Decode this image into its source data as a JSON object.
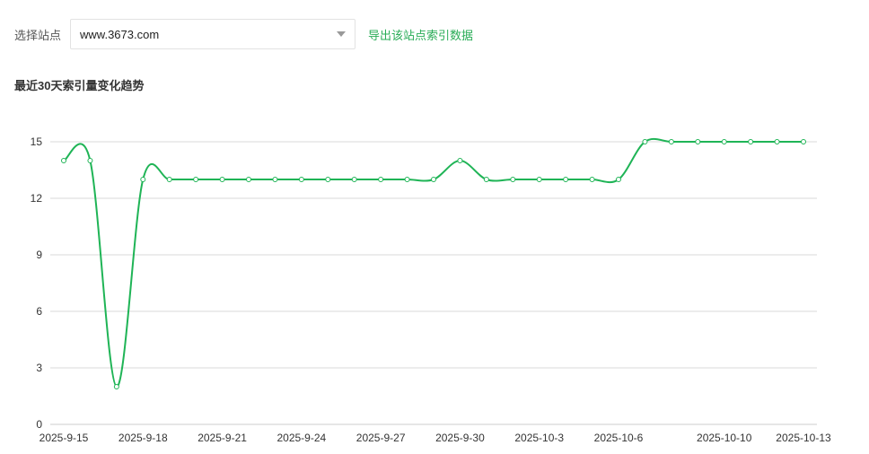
{
  "toolbar": {
    "site_label": "选择站点",
    "selected_site": "www.3673.com",
    "export_link": "导出该站点索引数据"
  },
  "colors": {
    "accent": "#2aac57",
    "line": "#1fb456",
    "grid": "#d9d9d9"
  },
  "chart_data": {
    "type": "line",
    "title": "最近30天索引量变化趋势",
    "xlabel": "",
    "ylabel": "",
    "ylim": [
      0,
      15
    ],
    "yticks": [
      0,
      3,
      6,
      9,
      12,
      15
    ],
    "grid": true,
    "x": [
      "2025-9-15",
      "2025-9-16",
      "2025-9-17",
      "2025-9-18",
      "2025-9-19",
      "2025-9-20",
      "2025-9-21",
      "2025-9-22",
      "2025-9-23",
      "2025-9-24",
      "2025-9-25",
      "2025-9-26",
      "2025-9-27",
      "2025-9-28",
      "2025-9-29",
      "2025-9-30",
      "2025-10-1",
      "2025-10-2",
      "2025-10-3",
      "2025-10-4",
      "2025-10-5",
      "2025-10-6",
      "2025-10-7",
      "2025-10-8",
      "2025-10-9",
      "2025-10-10",
      "2025-10-11",
      "2025-10-12",
      "2025-10-13"
    ],
    "xtick_labels": [
      "2025-9-15",
      "2025-9-18",
      "2025-9-21",
      "2025-9-24",
      "2025-9-27",
      "2025-9-30",
      "2025-10-3",
      "2025-10-6",
      "2025-10-10",
      "2025-10-13"
    ],
    "series": [
      {
        "values": [
          14,
          14,
          2,
          13,
          13,
          13,
          13,
          13,
          13,
          13,
          13,
          13,
          13,
          13,
          13,
          14,
          13,
          13,
          13,
          13,
          13,
          13,
          15,
          15,
          15,
          15,
          15,
          15,
          15
        ]
      }
    ]
  }
}
